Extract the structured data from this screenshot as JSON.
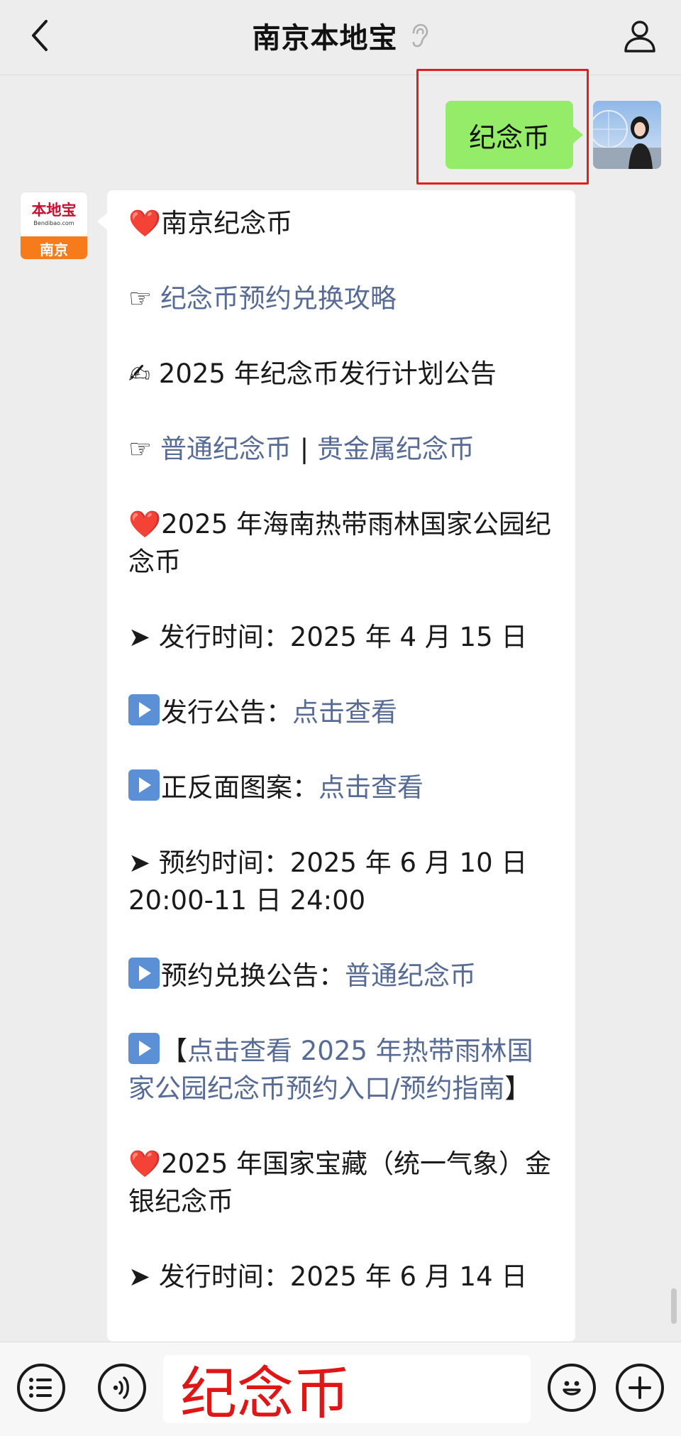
{
  "header": {
    "title": "南京本地宝",
    "back_icon": "chevron-left-icon",
    "muted_icon": "ear-icon",
    "profile_icon": "person-icon"
  },
  "user_message": {
    "text": "纪念币"
  },
  "bot": {
    "avatar_logo_cn": "本地宝",
    "avatar_logo_en": "Bendibao.com",
    "avatar_city": "南京",
    "lines": {
      "l1": "南京纪念币",
      "l2_link": "纪念币预约兑换攻略",
      "l3": "2025 年纪念币发行计划公告",
      "l4_link_a": "普通纪念币",
      "l4_sep": " | ",
      "l4_link_b": "贵金属纪念币",
      "l5": "2025 年海南热带雨林国家公园纪念币",
      "l6": "发行时间：2025 年 4 月 15 日",
      "l7_label": "发行公告：",
      "l7_link": "点击查看",
      "l8_label": "正反面图案：",
      "l8_link": "点击查看",
      "l9": "预约时间：2025 年 6 月 10 日 20:00-11 日 24:00",
      "l10_label": "预约兑换公告：",
      "l10_link": "普通纪念币",
      "l11_open": "【",
      "l11_link": "点击查看 2025 年热带雨林国家公园纪念币预约入口/预约指南",
      "l11_close": "】",
      "l12": "2025 年国家宝藏（统一气象）金银纪念币",
      "l13": "发行时间：2025 年 6 月 14 日"
    },
    "symbols": {
      "heart": "❤️",
      "pointer": "☞",
      "writing": "✍",
      "arrow": "➤"
    }
  },
  "input_bar": {
    "menu_icon": "list-menu-icon",
    "voice_icon": "voice-icon",
    "input_value": "纪念币",
    "emoji_icon": "emoji-icon",
    "plus_icon": "plus-icon"
  },
  "colors": {
    "background": "#ededed",
    "user_bubble": "#95ec69",
    "link": "#576b95",
    "highlight": "#e02020",
    "input_text": "#e01515"
  }
}
